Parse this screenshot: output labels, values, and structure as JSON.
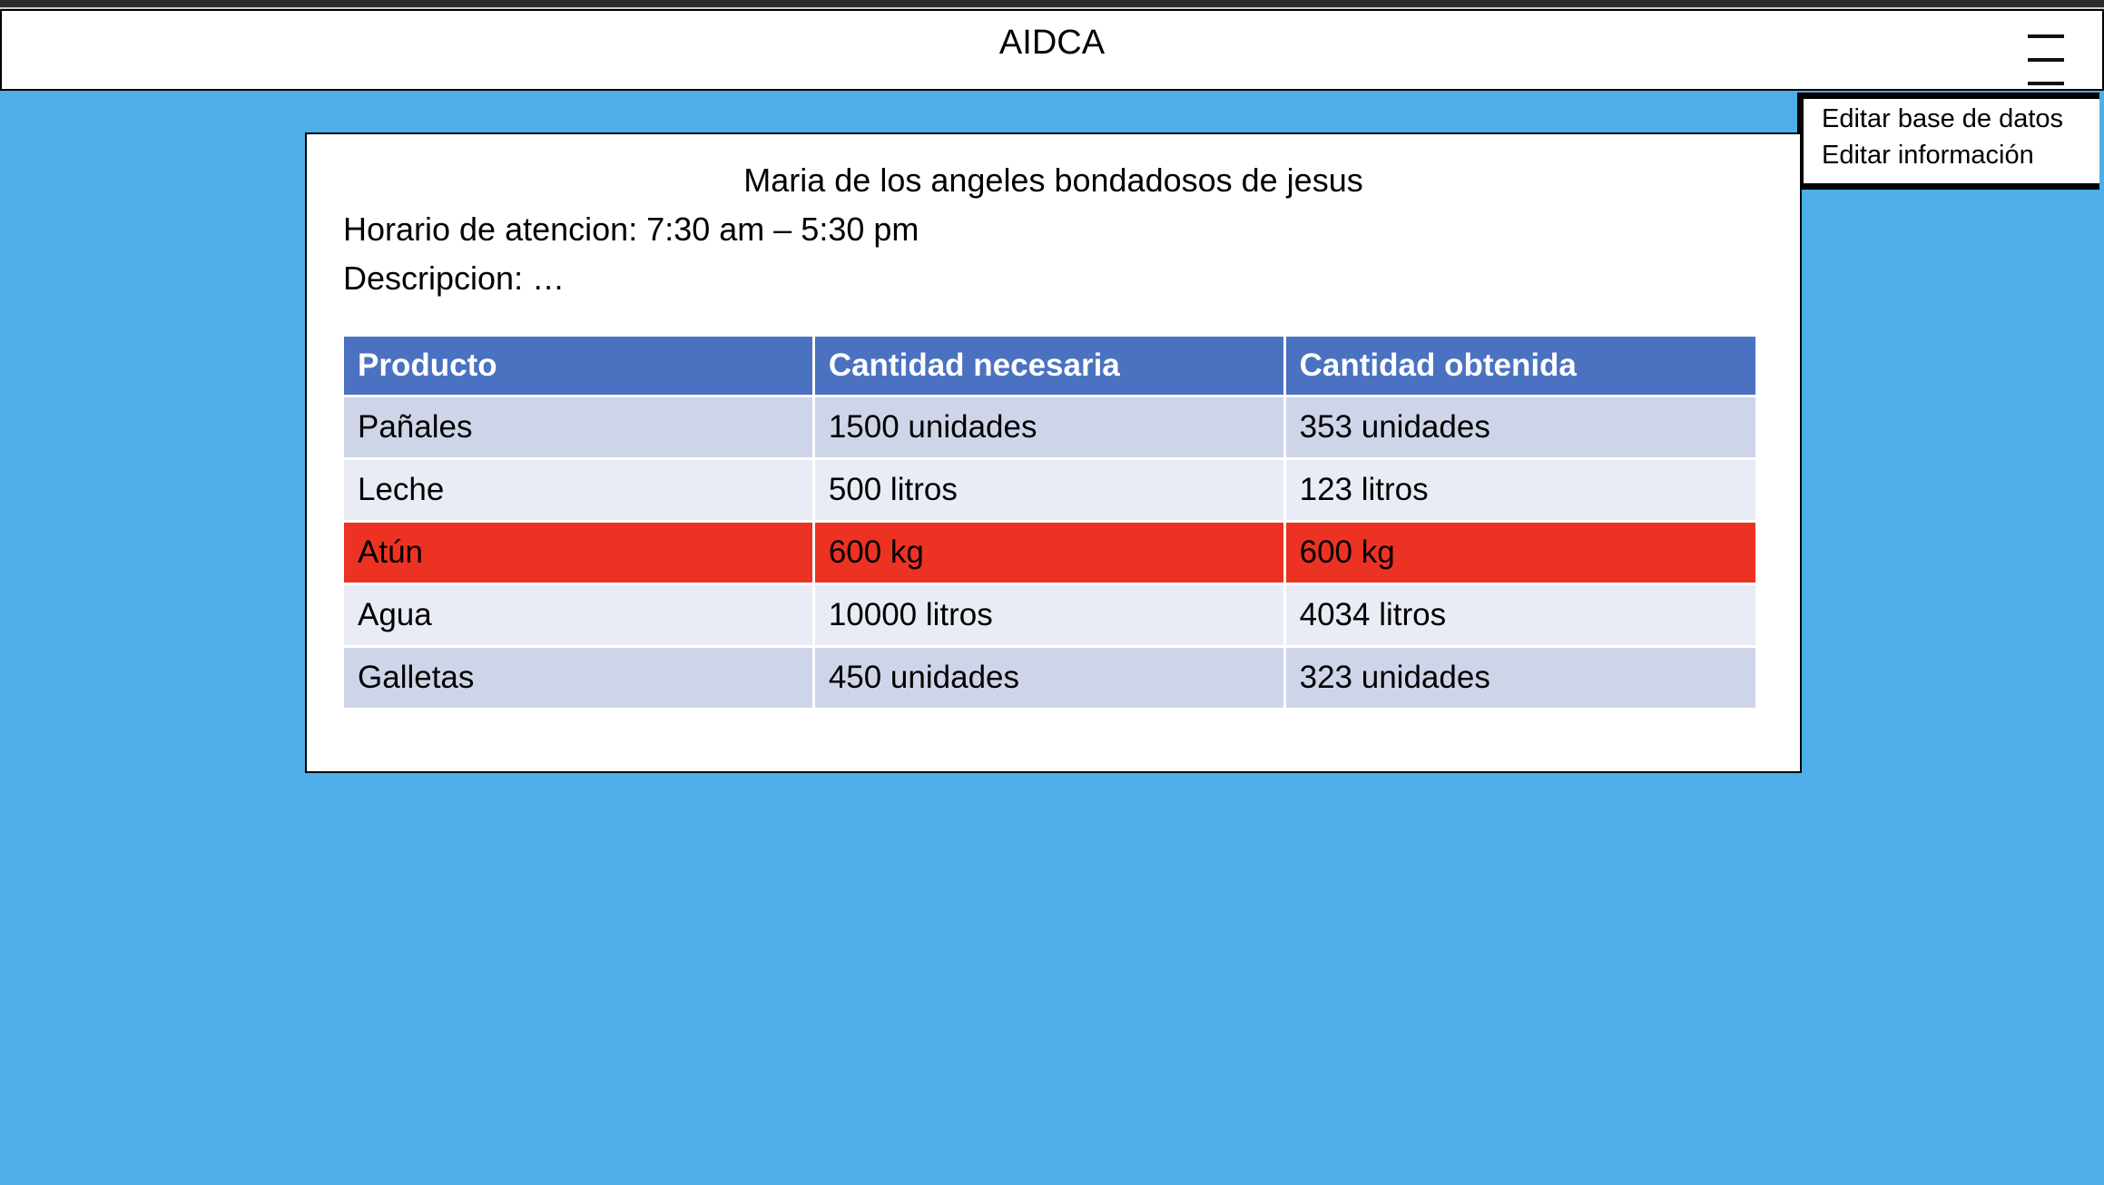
{
  "header": {
    "title": "AIDCA",
    "menu_icon": "hamburger-icon"
  },
  "menu": {
    "items": [
      {
        "label": "Editar base de datos"
      },
      {
        "label": "Editar información"
      }
    ]
  },
  "card": {
    "name": "Maria de los angeles bondadosos de jesus",
    "hours": "Horario de atencion: 7:30 am – 5:30 pm",
    "description": "Descripcion: …"
  },
  "table": {
    "headers": [
      "Producto",
      "Cantidad necesaria",
      "Cantidad obtenida"
    ],
    "rows": [
      [
        "Pañales",
        "1500 unidades",
        "353 unidades"
      ],
      [
        "Leche",
        "500 litros",
        "123 litros"
      ],
      [
        "Atún",
        "600 kg",
        "600 kg"
      ],
      [
        "Agua",
        "10000 litros",
        "4034 litros"
      ],
      [
        "Galletas",
        "450 unidades",
        "323 unidades"
      ]
    ]
  },
  "colors": {
    "background": "#4eaee8",
    "table_header": "#4a72c0",
    "row_alt1": "#cfd5e9",
    "row_alt2": "#e9ebf5",
    "complete_row": "#ec3323"
  }
}
